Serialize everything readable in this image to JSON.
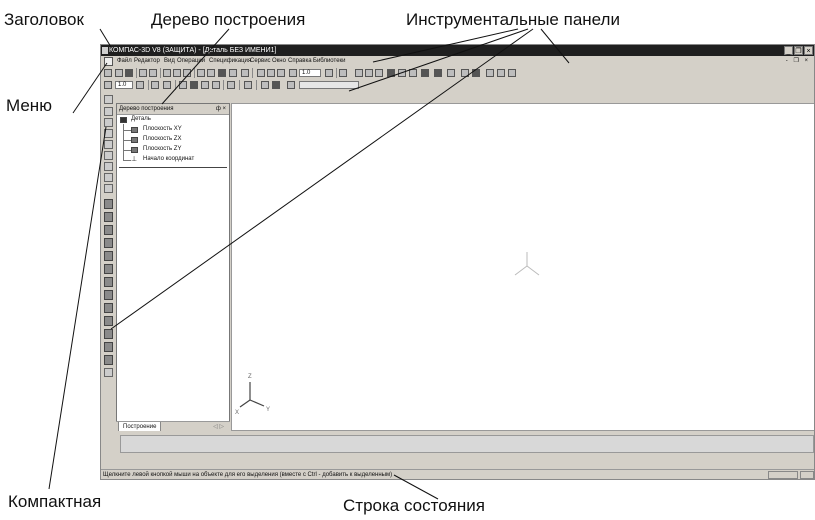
{
  "annotations": {
    "title_label": "Заголовок",
    "tree_label": "Дерево построения",
    "toolbars_label": "Инструментальные панели",
    "menu_label": "Меню",
    "compact_label": "Компактная",
    "status_label": "Строка состояния"
  },
  "window": {
    "title": "КОМПАС-3D V8 (ЗАЩИТА) - [Деталь БЕЗ ИМЕНИ1]",
    "controls": [
      "_",
      "❐",
      "×"
    ],
    "mdi_controls": "- ❐ ×"
  },
  "menu": {
    "items": [
      "Файл",
      "Редактор",
      "Вид",
      "Операции",
      "Спецификация",
      "Сервис",
      "Окно",
      "Справка",
      "Библиотеки"
    ]
  },
  "toolbar": {
    "zoom_value": "1.0",
    "step_value": "1.0"
  },
  "tree": {
    "header": "Дерево построения",
    "header_controls": "ф ×",
    "root": "Деталь",
    "nodes": [
      "Плоскость XY",
      "Плоскость ZX",
      "Плоскость ZY",
      "Начало координат"
    ],
    "tab_label": "Построение",
    "tab_arrows": "◁ ▷"
  },
  "canvas": {
    "axes_labels": [
      "Z",
      "X",
      "Y"
    ]
  },
  "status": {
    "text": "Щелкните левой кнопкой мыши на объекте для его выделения (вместе с Ctrl - добавить к выделенным)"
  },
  "colors": {
    "window_bg": "#d4d0c8",
    "titlebar": "#1f1f1f",
    "canvas": "#ffffff"
  }
}
